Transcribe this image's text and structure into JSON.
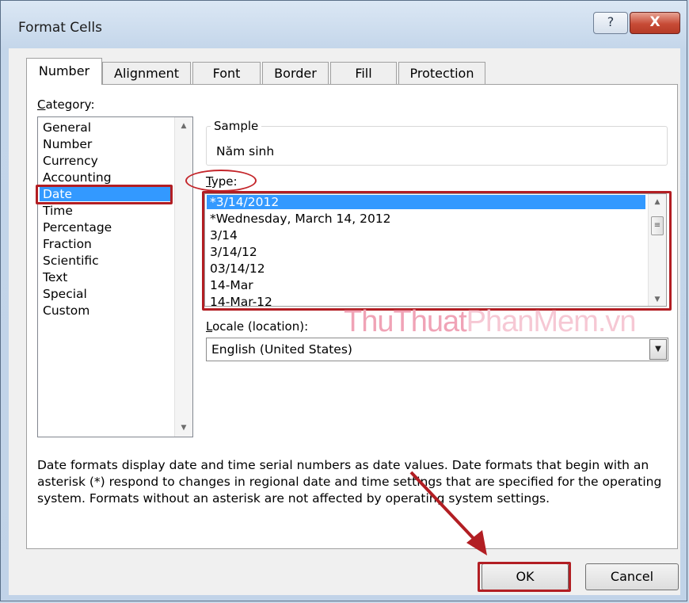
{
  "window": {
    "title": "Format Cells",
    "help_glyph": "?",
    "close_glyph": "X"
  },
  "tabs": [
    {
      "label": "Number",
      "active": true
    },
    {
      "label": "Alignment"
    },
    {
      "label": "Font"
    },
    {
      "label": "Border"
    },
    {
      "label": "Fill"
    },
    {
      "label": "Protection"
    }
  ],
  "category": {
    "label_underlined": "C",
    "label_rest": "ategory:",
    "items": [
      "General",
      "Number",
      "Currency",
      "Accounting",
      "Date",
      "Time",
      "Percentage",
      "Fraction",
      "Scientific",
      "Text",
      "Special",
      "Custom"
    ],
    "selected": "Date"
  },
  "sample": {
    "label": "Sample",
    "value": "Năm sinh"
  },
  "type": {
    "label_underlined": "T",
    "label_rest": "ype:",
    "items": [
      "*3/14/2012",
      "*Wednesday, March 14, 2012",
      "3/14",
      "3/14/12",
      "03/14/12",
      "14-Mar",
      "14-Mar-12"
    ],
    "selected": "*3/14/2012"
  },
  "locale": {
    "label_underlined": "L",
    "label_rest": "ocale (location):",
    "value": "English (United States)"
  },
  "description": "Date formats display date and time serial numbers as date values.  Date formats that begin with an asterisk (*) respond to changes in regional date and time settings that are specified for the operating system. Formats without an asterisk are not affected by operating system settings.",
  "buttons": {
    "ok": "OK",
    "cancel": "Cancel"
  },
  "watermark": {
    "part1": "ThuThuat",
    "part2": "PhanMem.vn"
  },
  "colors": {
    "annotation_red": "#b21e23",
    "selection_blue": "#3399ff"
  }
}
